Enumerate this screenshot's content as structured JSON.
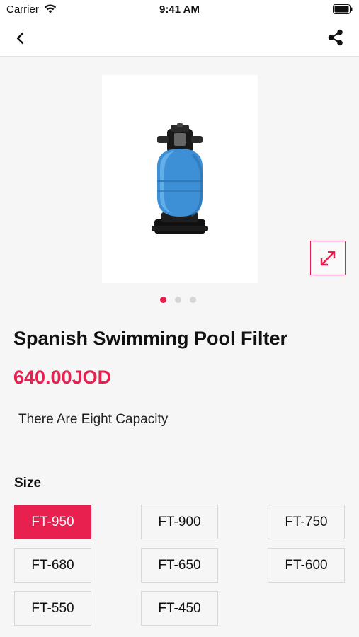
{
  "status_bar": {
    "carrier": "Carrier",
    "time": "9:41 AM",
    "icons": [
      "wifi-icon",
      "battery-icon"
    ]
  },
  "nav": {
    "back_icon": "chevron-left-icon",
    "share_icon": "share-icon"
  },
  "product": {
    "image": "pool-filter-image",
    "title": "Spanish Swimming Pool Filter",
    "price": "640.00JOD",
    "description": "There Are Eight Capacity",
    "gallery_pages": 3,
    "gallery_active_page": 1
  },
  "size": {
    "heading": "Size",
    "options": [
      "FT-950",
      "FT-900",
      "FT-750",
      "FT-680",
      "FT-650",
      "FT-600",
      "FT-550",
      "FT-450"
    ],
    "selected": "FT-950"
  },
  "colors": {
    "accent": "#e8204f",
    "background": "#f6f6f6"
  }
}
